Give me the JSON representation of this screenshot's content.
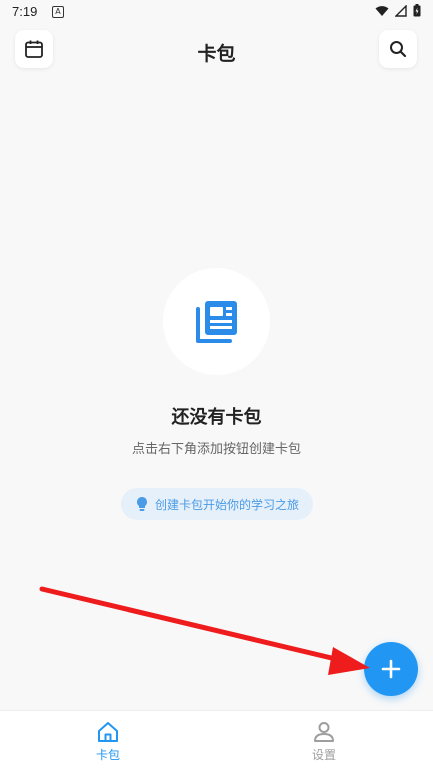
{
  "status_bar": {
    "time": "7:19",
    "notification": "A"
  },
  "header": {
    "title": "卡包"
  },
  "empty_state": {
    "title": "还没有卡包",
    "subtitle": "点击右下角添加按钮创建卡包",
    "hint": "创建卡包开始你的学习之旅"
  },
  "bottom_nav": [
    {
      "label": "卡包",
      "icon": "home-icon",
      "active": true
    },
    {
      "label": "设置",
      "icon": "person-icon",
      "active": false
    }
  ],
  "colors": {
    "accent": "#2196f3",
    "annotation_arrow": "#ee1c1c",
    "background": "#f8f8f8"
  }
}
